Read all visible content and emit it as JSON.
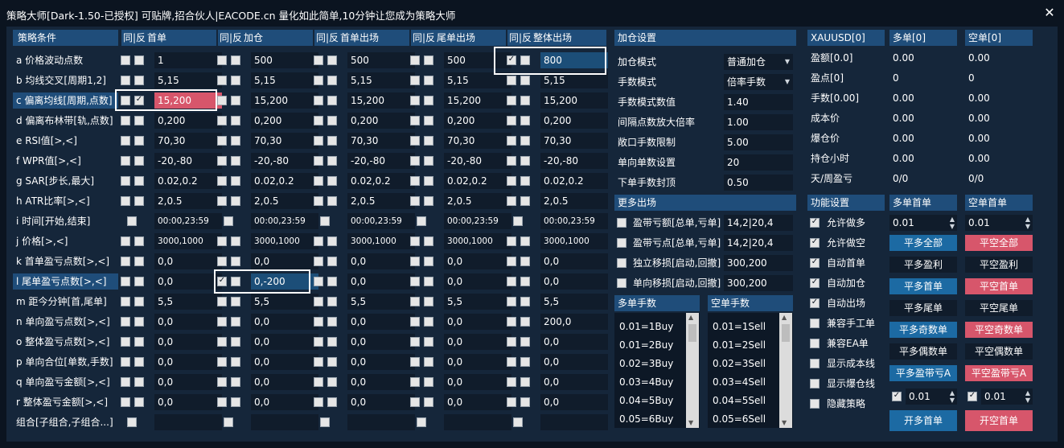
{
  "window": {
    "title": "策略大师[Dark-1.50-已授权]  可贴牌,招合伙人|EACODE.cn  量化如此简单,10分钟让您成为策略大师",
    "close_label": "✕"
  },
  "cond": {
    "headers": [
      "策略条件",
      "同|反",
      "首单",
      "同|反",
      "加仓",
      "同|反",
      "首单出场",
      "同|反",
      "尾单出场",
      "同|反",
      "整体出场"
    ],
    "rows": [
      {
        "label": "a 价格波动点数",
        "values": [
          "1",
          "500",
          "500",
          "500",
          "800"
        ]
      },
      {
        "label": "b 均线交叉[周期1,2]",
        "values": [
          "5,15",
          "5,15",
          "5,15",
          "5,15",
          "5,15"
        ]
      },
      {
        "label": "c 偏离均线[周期,点数]",
        "values": [
          "15,200",
          "15,200",
          "15,200",
          "15,200",
          "15,200"
        ]
      },
      {
        "label": "d 偏离布林带[轨,点数]",
        "values": [
          "0,200",
          "0,200",
          "0,200",
          "0,200",
          "0,200"
        ]
      },
      {
        "label": "e RSI值[>,<]",
        "values": [
          "70,30",
          "70,30",
          "70,30",
          "70,30",
          "70,30"
        ]
      },
      {
        "label": "f WPR值[>,<]",
        "values": [
          "-20,-80",
          "-20,-80",
          "-20,-80",
          "-20,-80",
          "-20,-80"
        ]
      },
      {
        "label": "g SAR[步长,最大]",
        "values": [
          "0.02,0.2",
          "0.02,0.2",
          "0.02,0.2",
          "0.02,0.2",
          "0.02,0.2"
        ]
      },
      {
        "label": "h ATR比率[>,<]",
        "values": [
          "2,0.5",
          "2,0.5",
          "2,0.5",
          "2,0.5",
          "2,0.5"
        ]
      },
      {
        "label": "i 时间[开始,结束]",
        "values": [
          "00:00,23:59",
          "00:00,23:59",
          "00:00,23:59",
          "00:00,23:59",
          "00:00,23:59"
        ]
      },
      {
        "label": "j 价格[>,<]",
        "values": [
          "3000,1000",
          "3000,1000",
          "3000,1000",
          "3000,1000",
          "3000,1000"
        ]
      },
      {
        "label": "k 首单盈亏点数[>,<]",
        "values": [
          "0,0",
          "0,0",
          "0,0",
          "0,0",
          "0,0"
        ]
      },
      {
        "label": "l 尾单盈亏点数[>,<]",
        "values": [
          "0,0",
          "0,-200",
          "0,0",
          "0,0",
          "0,0"
        ]
      },
      {
        "label": "m 距今分钟[首,尾单]",
        "values": [
          "5,5",
          "5,5",
          "5,5",
          "5,5",
          "5,5"
        ]
      },
      {
        "label": "n 单向盈亏点数[>,<]",
        "values": [
          "0,0",
          "0,0",
          "0,0",
          "0,0",
          "200,0"
        ]
      },
      {
        "label": "o 整体盈亏点数[>,<]",
        "values": [
          "0,0",
          "0,0",
          "0,0",
          "0,0",
          "0,0"
        ]
      },
      {
        "label": "p 单向合位[单数,手数]",
        "values": [
          "0,0",
          "0,0",
          "0,0",
          "0,0",
          "0,0"
        ]
      },
      {
        "label": "q 单向盈亏金额[>,<]",
        "values": [
          "0,0",
          "0,0",
          "0,0",
          "0,0",
          "0,0"
        ]
      },
      {
        "label": "r 整体盈亏金额[>,<]",
        "values": [
          "0,0",
          "0,0",
          "0,0",
          "0,0",
          "0,0"
        ]
      },
      {
        "label": "组合[子组合,子组合...]",
        "values": [
          "",
          "",
          "",
          "",
          ""
        ]
      }
    ]
  },
  "add": {
    "header": "加仓设置",
    "rows": [
      {
        "label": "加仓模式",
        "value": "普通加仓",
        "dropdown": true
      },
      {
        "label": "手数模式",
        "value": "倍率手数",
        "dropdown": true
      },
      {
        "label": "手数模式数值",
        "value": "1.40"
      },
      {
        "label": "间隔点数放大倍率",
        "value": "1.00"
      },
      {
        "label": "敞口手数限制",
        "value": "5.00"
      },
      {
        "label": "单向单数设置",
        "value": "20"
      },
      {
        "label": "下单手数封顶",
        "value": "0.50"
      }
    ]
  },
  "more": {
    "header": "更多出场",
    "rows": [
      {
        "label": "盈带亏额[总单,亏单]",
        "value": "14,2|20,4"
      },
      {
        "label": "盈带亏点[总单,亏单]",
        "value": "14,2|20,4"
      },
      {
        "label": "独立移损[启动,回撤]",
        "value": "300,200"
      },
      {
        "label": "单向移损[启动,回撤]",
        "value": "300,200"
      }
    ]
  },
  "lots": {
    "buy_header": "多单手数",
    "sell_header": "空单手数",
    "buy": [
      "0.01=1Buy",
      "0.01=2Buy",
      "0.02=3Buy",
      "0.03=4Buy",
      "0.04=5Buy",
      "0.05=6Buy"
    ],
    "sell": [
      "0.01=1Sell",
      "0.01=2Sell",
      "0.02=3Sell",
      "0.03=4Sell",
      "0.04=5Sell",
      "0.05=6Sell"
    ]
  },
  "stats": {
    "headers": [
      "XAUUSD[0]",
      "多单[0]",
      "空单[0]"
    ],
    "rows": [
      {
        "label": "盈额[0.0]",
        "buy": "0.00",
        "sell": "0.00"
      },
      {
        "label": "盈点[0]",
        "buy": "0",
        "sell": "0"
      },
      {
        "label": "手数[0.00]",
        "buy": "0.00",
        "sell": "0.00"
      },
      {
        "label": "成本价",
        "buy": "0.00",
        "sell": "0.00"
      },
      {
        "label": "爆仓价",
        "buy": "0.00",
        "sell": "0.00"
      },
      {
        "label": "持仓小时",
        "buy": "0.00",
        "sell": "0.00"
      },
      {
        "label": "天/周盈亏",
        "buy": "0/0",
        "sell": "0/0"
      }
    ]
  },
  "func": {
    "header": "功能设置",
    "buy_header": "多单首单",
    "sell_header": "空单首单",
    "items": [
      {
        "label": "允许做多",
        "checked": true
      },
      {
        "label": "允许做空",
        "checked": true
      },
      {
        "label": "自动首单",
        "checked": true
      },
      {
        "label": "自动加仓",
        "checked": true
      },
      {
        "label": "自动出场",
        "checked": true
      },
      {
        "label": "兼容手工单",
        "checked": false
      },
      {
        "label": "兼容EA单",
        "checked": false
      },
      {
        "label": "显示成本线",
        "checked": false
      },
      {
        "label": "显示爆仓线",
        "checked": false
      },
      {
        "label": "隐藏策略",
        "checked": false
      }
    ],
    "buy_lot": "0.01",
    "sell_lot": "0.01",
    "buttons": [
      [
        "平多全部",
        "平空全部"
      ],
      [
        "平多盈利",
        "平空盈利"
      ],
      [
        "平多首单",
        "平空首单"
      ],
      [
        "平多尾单",
        "平空尾单"
      ],
      [
        "平多奇数单",
        "平空奇数单"
      ],
      [
        "平多偶数单",
        "平空偶数单"
      ],
      [
        "平多盈带亏A",
        "平空盈带亏A"
      ]
    ],
    "bottom_buy_lot": "0.01",
    "bottom_sell_lot": "0.01",
    "open_buy": "开多首单",
    "open_sell": "开空首单"
  },
  "colors": {
    "background": "#15263a",
    "header": "#1f4d7a",
    "input": "#101c2b",
    "highlight_pink": "#d7566b",
    "button_blue": "#1c6aa3",
    "highlight_blue": "#1c4e78"
  }
}
